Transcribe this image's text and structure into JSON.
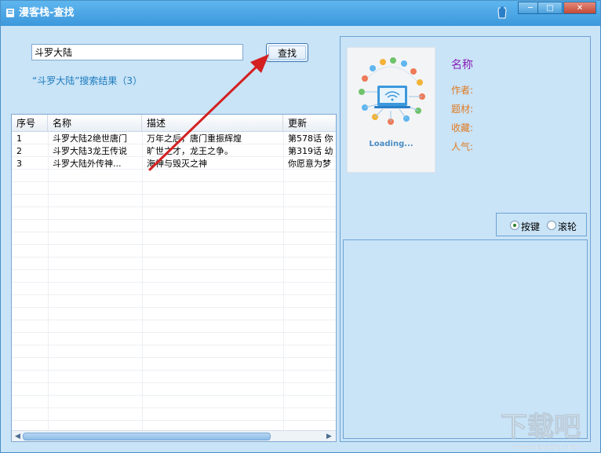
{
  "window": {
    "title": "漫客栈-查找",
    "controls": [
      "minimize",
      "maximize",
      "close"
    ]
  },
  "search": {
    "value": "斗罗大陆",
    "button_label": "查找",
    "result_summary": "“斗罗大陆”搜索结果（3）"
  },
  "table": {
    "columns": [
      "序号",
      "名称",
      "描述",
      "更新"
    ],
    "rows": [
      {
        "index": "1",
        "name": "斗罗大陆2绝世唐门",
        "desc": "万年之后，唐门重振辉煌",
        "update": "第578话 你"
      },
      {
        "index": "2",
        "name": "斗罗大陆3龙王传说",
        "desc": "旷世之才，龙王之争。",
        "update": "第319话 幼"
      },
      {
        "index": "3",
        "name": "斗罗大陆外传神...",
        "desc": "海神与毁灭之神",
        "update": "你愿意为梦"
      }
    ]
  },
  "detail": {
    "cover_text": "Loading...",
    "name_label": "名称",
    "author_label": "作者:",
    "genre_label": "题材:",
    "favorites_label": "收藏:",
    "popularity_label": "人气:"
  },
  "scroll_mode": {
    "options": [
      "按键",
      "滚轮"
    ],
    "selected": "按键"
  },
  "watermark": {
    "text": "下载吧",
    "url": "www.xiazaiba.com"
  },
  "colors": {
    "titlebar": "#3c98dc",
    "window_bg": "#c9e3f7",
    "result_text": "#1a7bbd",
    "name_label": "#8b1fb8",
    "info_label": "#e07a1f",
    "annotation_arrow": "#d42020"
  },
  "icons": [
    "app-icon",
    "skin-icon",
    "search-button",
    "radio-icon",
    "scroll-left-icon",
    "scroll-right-icon"
  ]
}
